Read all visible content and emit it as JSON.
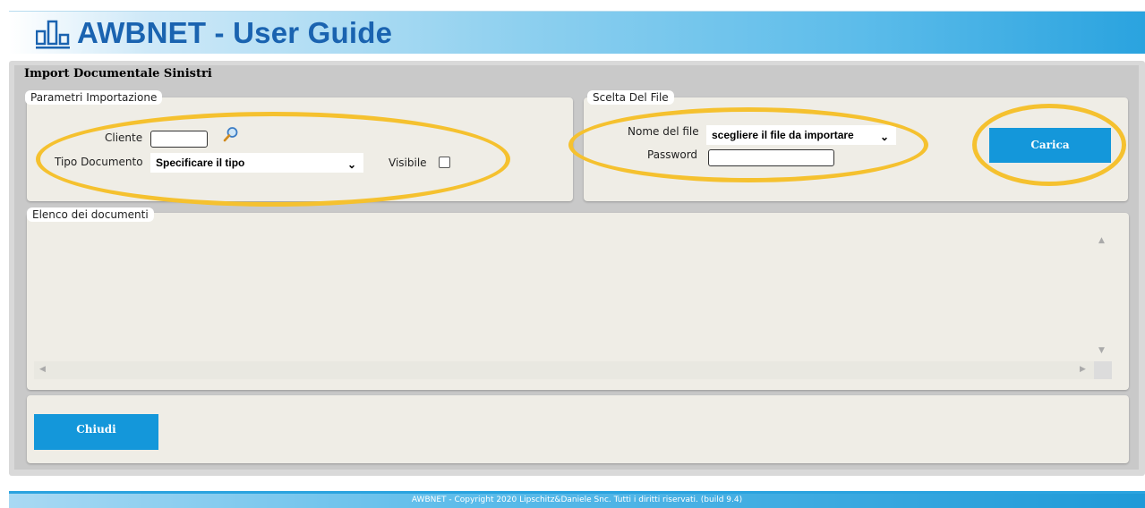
{
  "header": {
    "title": "AWBNET - User Guide",
    "logo_icon": "bar-chart-icon"
  },
  "page": {
    "title": "Import Documentale Sinistri"
  },
  "parametri": {
    "legend": "Parametri Importazione",
    "cliente_label": "Cliente",
    "cliente_value": "",
    "search_icon": "magnifier-icon",
    "tipo_documento_label": "Tipo Documento",
    "tipo_documento_selected": "Specificare il tipo",
    "visibile_label": "Visibile",
    "visibile_checked": false
  },
  "scelta_file": {
    "legend": "Scelta Del File",
    "nome_file_label": "Nome del file",
    "nome_file_selected": "scegliere il file da importare",
    "password_label": "Password",
    "password_value": "",
    "carica_label": "Carica"
  },
  "elenco": {
    "legend": "Elenco dei documenti"
  },
  "actions": {
    "chiudi_label": "Chiudi"
  },
  "footer": {
    "text": "AWBNET - Copyright 2020 Lipschitz&Daniele Snc. Tutti i diritti riservati. (build 9.4)"
  },
  "colors": {
    "accent_blue": "#1497da",
    "highlight_yellow": "#f5c12f",
    "panel_bg": "#efede6",
    "title_blue": "#1a63b0"
  }
}
